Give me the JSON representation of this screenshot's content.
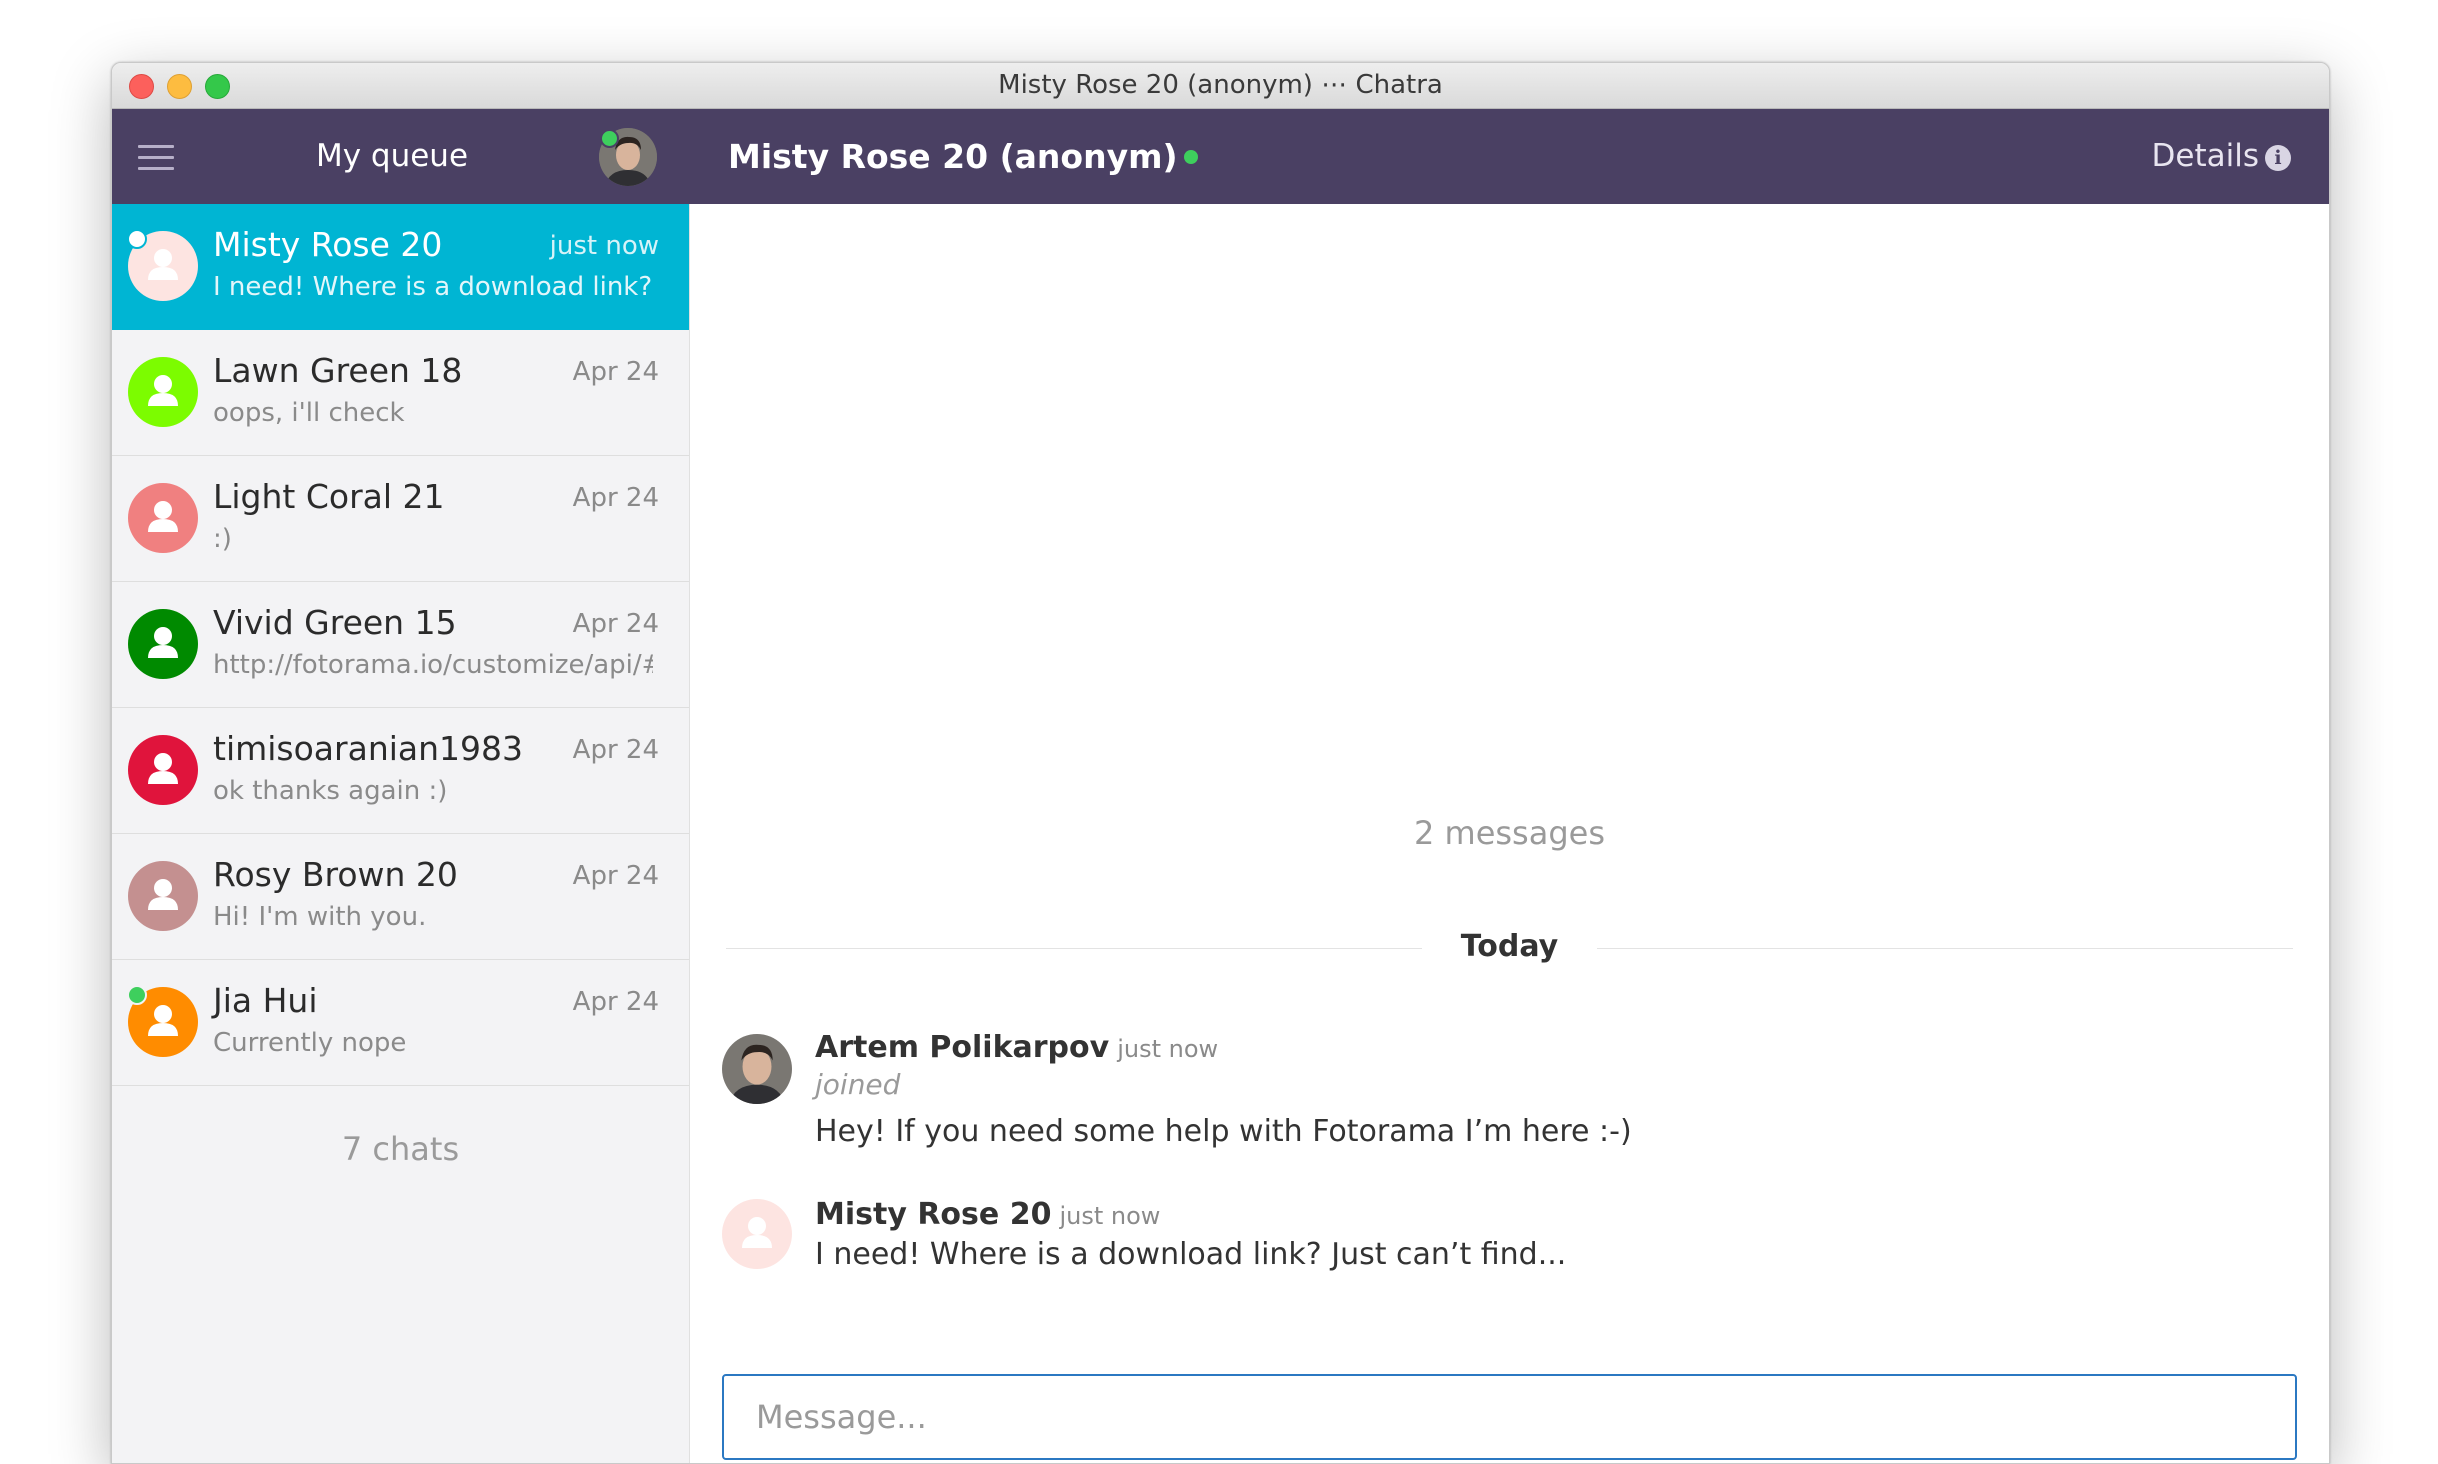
{
  "window": {
    "title": "Misty Rose 20 (anonym) ⋯ Chatra"
  },
  "header": {
    "queue_title": "My queue",
    "chat_title": "Misty Rose 20 (anonym)",
    "details_label": "Details",
    "online_color": "#3ecf5d"
  },
  "colors": {
    "header_bg": "#4a4063",
    "active_chat_bg": "#00b5d3",
    "sidebar_bg": "#f3f3f5",
    "composer_border": "#2b78c2"
  },
  "chats": [
    {
      "name": "Misty Rose 20",
      "time": "just now",
      "preview": "I need! Where is a download link? J...",
      "color": "#fde4e1",
      "active": true,
      "online": true
    },
    {
      "name": "Lawn Green 18",
      "time": "Apr 24",
      "preview": "oops, i'll check",
      "color": "#7cfc00",
      "active": false,
      "online": false
    },
    {
      "name": "Light Coral 21",
      "time": "Apr 24",
      "preview": ":)",
      "color": "#f08080",
      "active": false,
      "online": false
    },
    {
      "name": "Vivid Green 15",
      "time": "Apr 24",
      "preview": "http://fotorama.io/customize/api/#...",
      "color": "#008a00",
      "active": false,
      "online": false
    },
    {
      "name": "timisoaranian1983",
      "time": "Apr 24",
      "preview": "ok thanks again :)",
      "color": "#e0143c",
      "active": false,
      "online": false
    },
    {
      "name": "Rosy Brown 20",
      "time": "Apr 24",
      "preview": "Hi! I'm with you.",
      "color": "#c49090",
      "active": false,
      "online": false
    },
    {
      "name": "Jia Hui",
      "time": "Apr 24",
      "preview": "Currently nope",
      "color": "#ff8c00",
      "active": false,
      "online": true
    }
  ],
  "sidebar": {
    "chat_count": "7 chats"
  },
  "conversation": {
    "message_count": "2 messages",
    "day_label": "Today",
    "messages": [
      {
        "author": "Artem Polikarpov",
        "time": "just now",
        "note": "joined",
        "text": "Hey! If you need some help with Fotorama I’m here :-)"
      },
      {
        "author": "Misty Rose 20",
        "time": "just now",
        "text": "I need! Where is a download link? Just can’t find..."
      }
    ]
  },
  "composer": {
    "placeholder": "Message...",
    "value": ""
  }
}
